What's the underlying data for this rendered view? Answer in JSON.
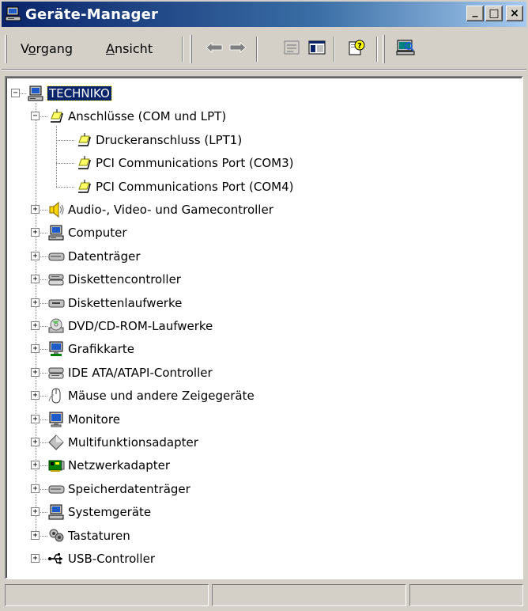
{
  "window": {
    "title": "Geräte-Manager"
  },
  "title_buttons": {
    "minimize": "_",
    "maximize": "□",
    "close": "×"
  },
  "menu": [
    {
      "label_pre": "V",
      "label_u": "o",
      "label_post": "rgang"
    },
    {
      "label_pre": "",
      "label_u": "A",
      "label_post": "nsicht"
    }
  ],
  "toolbar": [
    "back-icon",
    "forward-icon",
    "properties-icon",
    "show-hide-tree-icon",
    "help-icon",
    "scan-hardware-icon"
  ],
  "tree": {
    "root": {
      "label": "TECHNIKO",
      "expander": "−"
    },
    "ports": {
      "label": "Anschlüsse (COM und LPT)",
      "expander": "−",
      "children": [
        "Druckeranschluss (LPT1)",
        "PCI Communications Port (COM3)",
        "PCI Communications Port (COM4)"
      ]
    },
    "categories": [
      {
        "label": "Audio-, Video- und Gamecontroller",
        "icon": "speaker-icon"
      },
      {
        "label": "Computer",
        "icon": "computer-icon"
      },
      {
        "label": "Datenträger",
        "icon": "disk-drive-icon"
      },
      {
        "label": "Diskettencontroller",
        "icon": "floppy-controller-icon"
      },
      {
        "label": "Diskettenlaufwerke",
        "icon": "floppy-drive-icon"
      },
      {
        "label": "DVD/CD-ROM-Laufwerke",
        "icon": "cdrom-icon"
      },
      {
        "label": "Grafikkarte",
        "icon": "display-adapter-icon"
      },
      {
        "label": "IDE ATA/ATAPI-Controller",
        "icon": "ide-controller-icon"
      },
      {
        "label": "Mäuse und andere Zeigegeräte",
        "icon": "mouse-icon"
      },
      {
        "label": "Monitore",
        "icon": "monitor-icon"
      },
      {
        "label": "Multifunktionsadapter",
        "icon": "multifunction-icon"
      },
      {
        "label": "Netzwerkadapter",
        "icon": "network-adapter-icon"
      },
      {
        "label": "Speicherdatenträger",
        "icon": "storage-volume-icon"
      },
      {
        "label": "Systemgeräte",
        "icon": "system-devices-icon"
      },
      {
        "label": "Tastaturen",
        "icon": "keyboard-icon"
      },
      {
        "label": "USB-Controller",
        "icon": "usb-icon"
      }
    ],
    "collapsed_expander": "+"
  },
  "status": [
    "",
    "",
    ""
  ],
  "colors": {
    "titlebar_start": "#0a246a",
    "titlebar_end": "#a6caf0",
    "selection": "#0a246a",
    "face": "#d4d0c8"
  }
}
